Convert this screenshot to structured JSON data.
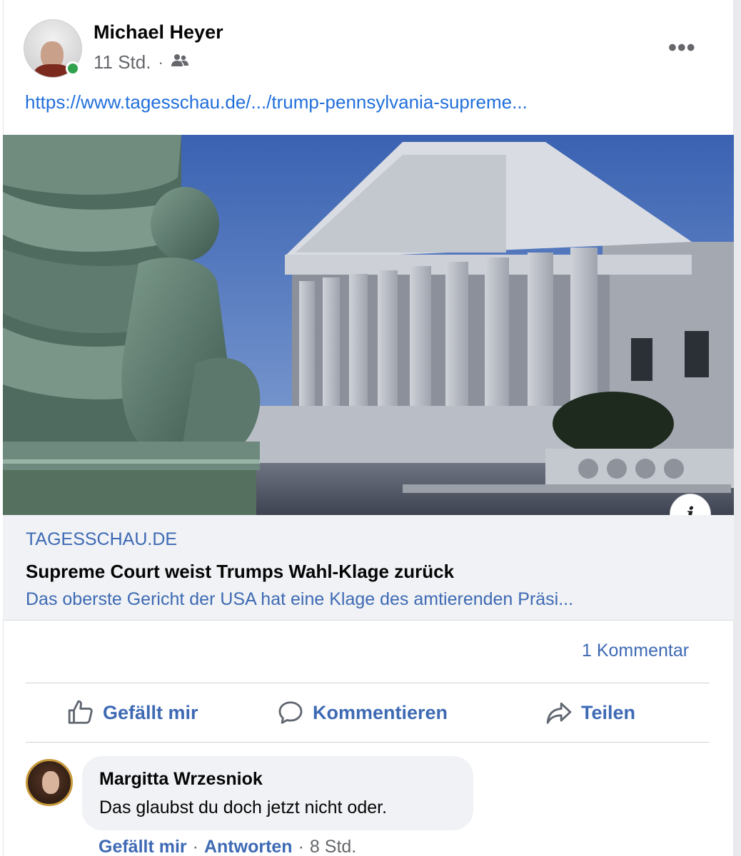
{
  "post": {
    "author": "Michael Heyer",
    "timestamp": "11 Std.",
    "separator": "·",
    "audience_icon": "friends-icon",
    "more_icon": "more-options-icon",
    "link_text": "https://www.tagesschau.de/.../trump-pennsylvania-supreme...",
    "online": true
  },
  "link_preview": {
    "domain": "TAGESSCHAU.DE",
    "title": "Supreme Court weist Trumps Wahl-Klage zurück",
    "description": "Das oberste Gericht der USA hat eine Klage des amtierenden Präsi...",
    "info_icon": "i"
  },
  "stats": {
    "comments": "1 Kommentar"
  },
  "actions": {
    "like": "Gefällt mir",
    "comment": "Kommentieren",
    "share": "Teilen"
  },
  "comment": {
    "author": "Margitta Wrzesniok",
    "text": "Das glaubst du doch jetzt nicht oder.",
    "like_label": "Gefällt mir",
    "reply_label": "Antworten",
    "separator": "·",
    "time": "8 Std."
  },
  "colors": {
    "link_blue": "#216fdb",
    "action_blue": "#3e6ab4",
    "online_green": "#31a24c",
    "preview_bg": "#f0f2f5"
  }
}
